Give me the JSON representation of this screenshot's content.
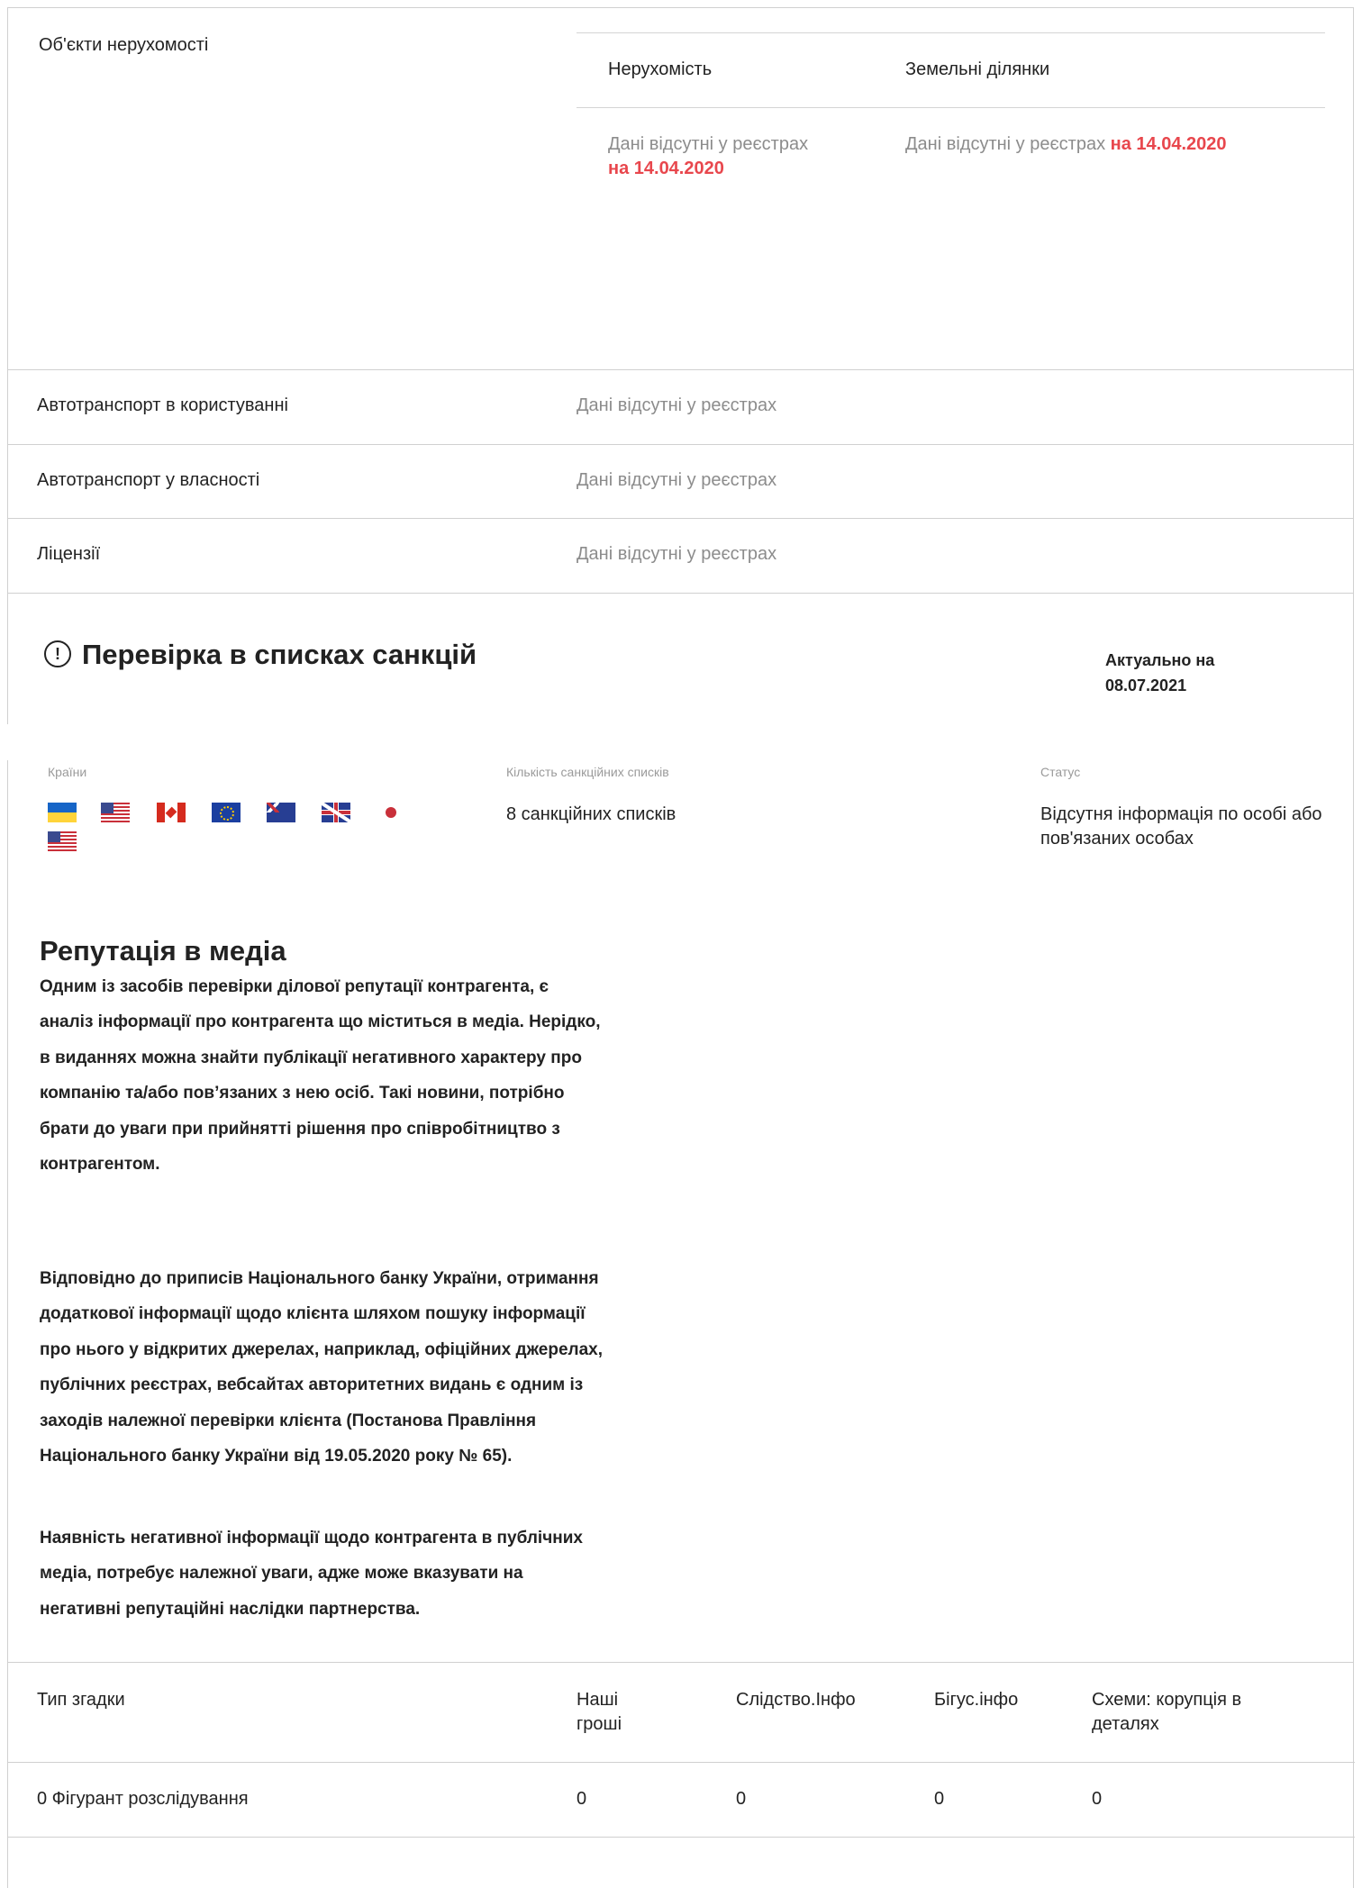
{
  "property": {
    "label": "Об'єкти нерухомості",
    "columns": [
      {
        "title": "Нерухомість",
        "text": "Дані відсутні у реєстрах",
        "date": "на 14.04.2020"
      },
      {
        "title": "Земельні ділянки",
        "text": "Дані відсутні у реєстрах",
        "date": "на 14.04.2020"
      }
    ]
  },
  "rows": [
    {
      "label": "Автотранспорт в користуванні",
      "value": "Дані відсутні у реєстрах"
    },
    {
      "label": "Автотранспорт у власності",
      "value": "Дані відсутні у реєстрах"
    },
    {
      "label": "Ліцензії",
      "value": "Дані відсутні у реєстрах"
    }
  ],
  "sanctions": {
    "icon": "exclamation-circle-icon",
    "title": "Перевірка в списках санкцій",
    "actual_label": "Актуально на",
    "actual_date": "08.07.2021",
    "countries_label": "Країни",
    "countries": [
      "ua-flag-icon",
      "us-flag-icon",
      "ca-flag-icon",
      "eu-flag-icon",
      "au-flag-icon",
      "gb-flag-icon",
      "jp-flag-icon",
      "us-flag-icon"
    ],
    "count_label": "Кількість санкційних списків",
    "count_value": "8 санкційних списків",
    "status_label": "Статус",
    "status_value": "Відсутня інформація по особі або пов'язаних особах"
  },
  "media": {
    "title": "Репутація в медіа",
    "paragraphs": [
      "Одним із засобів перевірки ділової репутації контрагента, є аналіз інформації про контрагента що міститься в медіа. Нерідко, в виданнях можна знайти публікації негативного характеру про компанію та/або пов’язаних з нею осіб. Такі новини, потрібно брати до уваги при прийнятті рішення про співробітництво з контрагентом.",
      "Відповідно до приписів Національного банку України, отримання додаткової інформації щодо клієнта шляхом пошуку інформації про нього у відкритих джерелах, наприклад, офіційних джерелах, публічних реєстрах, вебсайтах авторитетних видань є одним із заходів належної перевірки клієнта (Постанова Правління Національного банку України від 19.05.2020 року № 65).",
      "Наявність негативної інформації щодо контрагента в публічних медіа, потребує належної уваги, адже може вказувати на негативні репутаційні наслідки партнерства."
    ]
  },
  "mentions": {
    "headers": [
      "Тип згадки",
      "Наші гроші",
      "Слідство.Інфо",
      "Бігус.інфо",
      "Схеми: корупція в деталях"
    ],
    "row": [
      "0 Фігурант розслідування",
      "0",
      "0",
      "0",
      "0"
    ]
  }
}
